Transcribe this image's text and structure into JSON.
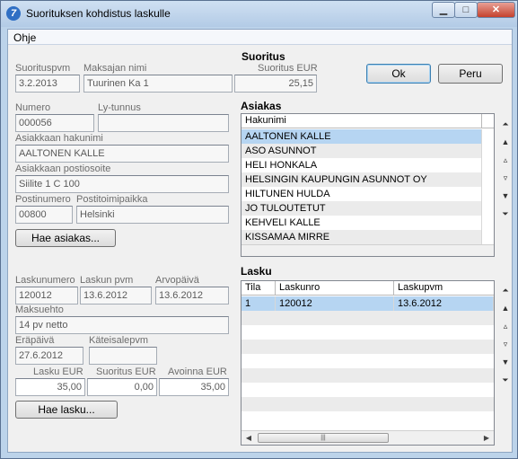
{
  "window": {
    "title": "Suorituksen kohdistus laskulle",
    "app_icon": "7",
    "min_glyph": "▁",
    "max_glyph": "□",
    "close_glyph": "✕"
  },
  "menu": {
    "ohje": "Ohje"
  },
  "suoritus": {
    "heading": "Suoritus",
    "pvm_label": "Suorituspvm",
    "pvm": "3.2.2013",
    "maksaja_label": "Maksajan nimi",
    "maksaja": "Tuurinen Ka 1",
    "eur_label": "Suoritus EUR",
    "eur": "25,15"
  },
  "buttons": {
    "ok": "Ok",
    "peru": "Peru",
    "hae_asiakas": "Hae asiakas...",
    "hae_lasku": "Hae lasku..."
  },
  "asiakas_form": {
    "numero_label": "Numero",
    "numero": "000056",
    "ytunnus_label": "Ly-tunnus",
    "ytunnus": "",
    "hakunimi_label": "Asiakkaan hakunimi",
    "hakunimi": "AALTONEN KALLE",
    "osoite_label": "Asiakkaan postiosoite",
    "osoite": "Siilite 1 C 100",
    "postinumero_label": "Postinumero",
    "postinumero": "00800",
    "postitoimipaikka_label": "Postitoimipaikka",
    "postitoimipaikka": "Helsinki"
  },
  "lasku_form": {
    "laskunumero_label": "Laskunumero",
    "laskunumero": "120012",
    "laskupvm_label": "Laskun pvm",
    "laskupvm": "13.6.2012",
    "arvopaiva_label": "Arvopäivä",
    "arvopaiva": "13.6.2012",
    "maksuehto_label": "Maksuehto",
    "maksuehto": "14 pv netto",
    "erapaiva_label": "Eräpäivä",
    "erapaiva": "27.6.2012",
    "kateisalepvm_label": "Käteisalepvm",
    "kateisalepvm": "",
    "lasku_eur_label": "Lasku EUR",
    "lasku_eur": "35,00",
    "suoritus_eur_label": "Suoritus EUR",
    "suoritus_eur": "0,00",
    "avoinna_eur_label": "Avoinna EUR",
    "avoinna_eur": "35,00"
  },
  "asiakas_grid": {
    "heading": "Asiakas",
    "column": "Hakunimi",
    "rows": [
      "AALTONEN KALLE",
      "ASO ASUNNOT",
      "HELI HONKALA",
      "HELSINGIN KAUPUNGIN ASUNNOT OY",
      "HILTUNEN HULDA",
      "JO TULOUTETUT",
      "KEHVELI KALLE",
      "KISSAMAA MIRRE"
    ]
  },
  "lasku_grid": {
    "heading": "Lasku",
    "columns": [
      "Tila",
      "Laskunro",
      "Laskupvm"
    ],
    "rows": [
      [
        "1",
        "120012",
        "13.6.2012"
      ]
    ]
  },
  "nav_icons": {
    "first": "first-icon",
    "page_up": "page-up-icon",
    "up": "up-icon",
    "down": "down-icon",
    "page_down": "page-down-icon",
    "last": "last-icon"
  },
  "nav_glyphs": {
    "first": "⏶",
    "page_up": "▲",
    "up": "▵",
    "down": "▿",
    "page_down": "▼",
    "last": "⏷"
  },
  "scroll_glyphs": {
    "left": "◀",
    "right": "▶",
    "grip": "|||"
  }
}
